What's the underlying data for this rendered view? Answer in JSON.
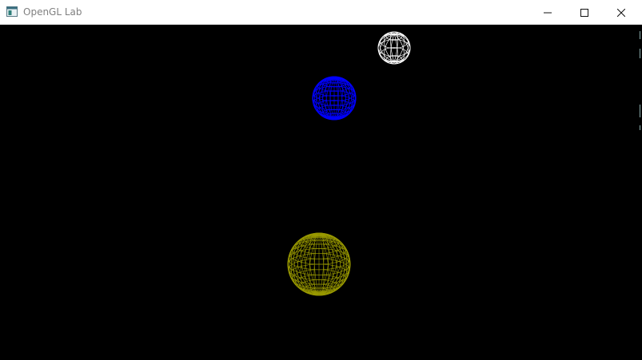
{
  "window": {
    "title": "OpenGL Lab",
    "icons": {
      "app": "app-window-icon",
      "minimize": "minimize-icon",
      "maximize": "maximize-icon",
      "close": "close-icon"
    }
  },
  "scene": {
    "background": "#000000",
    "spheres": [
      {
        "name": "white",
        "color": "#ffffff"
      },
      {
        "name": "blue",
        "color": "#0000ff"
      },
      {
        "name": "yellow",
        "color": "#9a9a00"
      }
    ]
  }
}
